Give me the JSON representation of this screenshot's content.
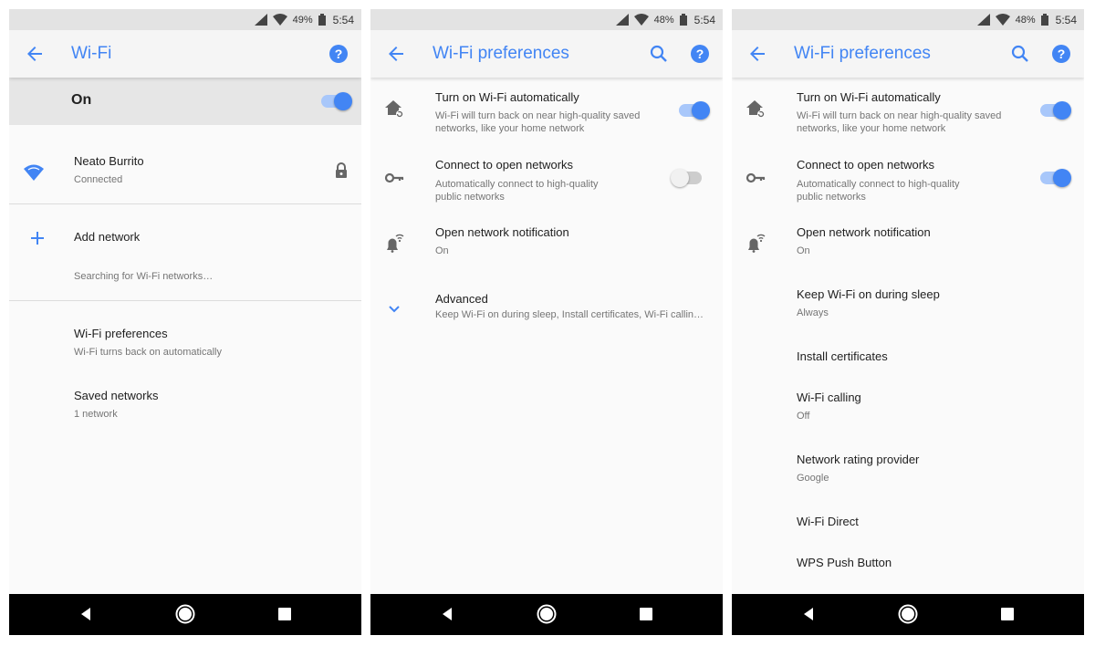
{
  "status_bar": {
    "screen1": {
      "battery": "49%",
      "time": "5:54"
    },
    "screen2": {
      "battery": "48%",
      "time": "5:54"
    },
    "screen3": {
      "battery": "48%",
      "time": "5:54"
    }
  },
  "screen1": {
    "title": "Wi-Fi",
    "master_label": "On",
    "master_on": true,
    "connected_network": {
      "name": "Neato Burrito",
      "status": "Connected"
    },
    "add_network": "Add network",
    "searching": "Searching for Wi-Fi networks…",
    "preferences": {
      "title": "Wi-Fi preferences",
      "summary": "Wi-Fi turns back on automatically"
    },
    "saved": {
      "title": "Saved networks",
      "summary": "1 network"
    }
  },
  "screen2": {
    "title": "Wi-Fi preferences",
    "items": [
      {
        "title": "Turn on Wi-Fi automatically",
        "summary1": "Wi-Fi will turn back on near high-quality saved",
        "summary2": "networks, like your home network",
        "on": true
      },
      {
        "title": "Connect to open networks",
        "summary1": "Automatically connect to high-quality",
        "summary2": "public networks",
        "on": false
      },
      {
        "title": "Open network notification",
        "summary": "On"
      }
    ],
    "advanced": {
      "title": "Advanced",
      "summary": "Keep Wi-Fi on during sleep, Install certificates, Wi-Fi calling, …"
    }
  },
  "screen3": {
    "title": "Wi-Fi preferences",
    "items": [
      {
        "title": "Turn on Wi-Fi automatically",
        "summary1": "Wi-Fi will turn back on near high-quality saved",
        "summary2": "networks, like your home network",
        "on": true
      },
      {
        "title": "Connect to open networks",
        "summary1": "Automatically connect to high-quality",
        "summary2": "public networks",
        "on": true
      },
      {
        "title": "Open network notification",
        "summary": "On"
      },
      {
        "title": "Keep Wi-Fi on during sleep",
        "summary": "Always"
      },
      {
        "title": "Install certificates"
      },
      {
        "title": "Wi-Fi calling",
        "summary": "Off"
      },
      {
        "title": "Network rating provider",
        "summary": "Google"
      },
      {
        "title": "Wi-Fi Direct"
      },
      {
        "title": "WPS Push Button"
      }
    ]
  },
  "icons": {
    "back": "arrow-back-icon",
    "help": "help-circle-icon",
    "search": "search-icon",
    "wifi": "wifi-signal-icon",
    "lock": "lock-icon",
    "add": "plus-icon",
    "home_wifi": "home-sync-icon",
    "key": "key-icon",
    "notification": "notification-wifi-icon",
    "expand": "chevron-down-icon",
    "nav_back": "nav-back-triangle-icon",
    "nav_home": "nav-home-circle-icon",
    "nav_recents": "nav-recents-square-icon"
  },
  "colors": {
    "accent": "#4285f4",
    "toggle_track_on": "#a8c7fa",
    "master_bar": "#e6e6e6",
    "status_bar": "#e3e3e3",
    "nav_bar": "#000000"
  }
}
